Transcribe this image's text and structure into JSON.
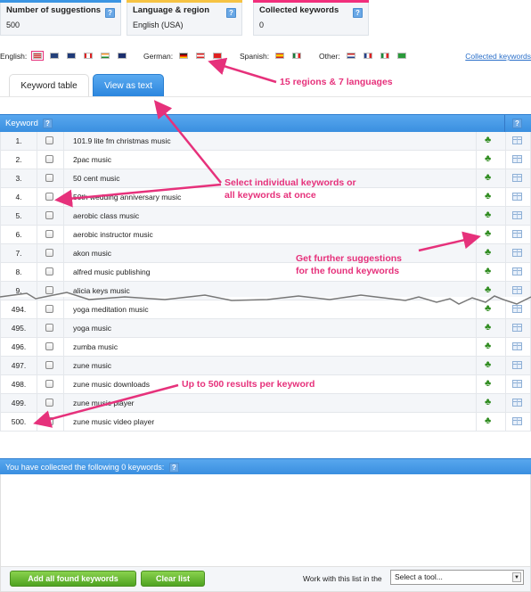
{
  "stats": [
    {
      "title": "Number of suggestions",
      "value": "500",
      "color": "#3b95e3"
    },
    {
      "title": "Language & region",
      "value": "English (USA)",
      "color": "#f6c343"
    },
    {
      "title": "Collected keywords",
      "value": "0",
      "color": "#f12f7c"
    }
  ],
  "help_label": "?",
  "languages": {
    "english_label": "English:",
    "english_flags": [
      "flag-usa",
      "flag-uk",
      "flag-australia",
      "flag-canada",
      "flag-india",
      "flag-new-zealand"
    ],
    "german_label": "German:",
    "german_flags": [
      "flag-germany",
      "flag-austria",
      "flag-switzerland"
    ],
    "spanish_label": "Spanish:",
    "spanish_flags": [
      "flag-spain",
      "flag-mexico"
    ],
    "other_label": "Other:",
    "other_flags": [
      "flag-netherlands",
      "flag-france",
      "flag-italy",
      "flag-brazil"
    ],
    "collected_link": "Collected keywords"
  },
  "tabs": [
    {
      "label": "Keyword table",
      "active": true
    },
    {
      "label": "View as text",
      "active": false
    }
  ],
  "table": {
    "header": "Keyword",
    "rows": [
      {
        "num": "1.",
        "keyword": "101.9 lite fm christmas music"
      },
      {
        "num": "2.",
        "keyword": "2pac music"
      },
      {
        "num": "3.",
        "keyword": "50 cent music"
      },
      {
        "num": "4.",
        "keyword": "50th wedding anniversary music"
      },
      {
        "num": "5.",
        "keyword": "aerobic class music"
      },
      {
        "num": "6.",
        "keyword": "aerobic instructor music"
      },
      {
        "num": "7.",
        "keyword": "akon music"
      },
      {
        "num": "8.",
        "keyword": "alfred music publishing"
      },
      {
        "num": "9.",
        "keyword": "alicia keys music"
      },
      {
        "num": "494.",
        "keyword": "yoga meditation music"
      },
      {
        "num": "495.",
        "keyword": "yoga music"
      },
      {
        "num": "496.",
        "keyword": "zumba music"
      },
      {
        "num": "497.",
        "keyword": "zune music"
      },
      {
        "num": "498.",
        "keyword": "zune music downloads"
      },
      {
        "num": "499.",
        "keyword": "zune music player"
      },
      {
        "num": "500.",
        "keyword": "zune music video player"
      }
    ]
  },
  "collected": {
    "header": "You have collected the following 0 keywords:",
    "add_all_label": "Add all found keywords",
    "clear_label": "Clear list",
    "tool_label": "Work with this list in the",
    "tool_select": "Select a tool..."
  },
  "annotations": {
    "regions": "15 regions & 7 languages",
    "select_line1": "Select individual keywords or",
    "select_line2": "all keywords at once",
    "further_line1": "Get further suggestions",
    "further_line2": "for the found keywords",
    "results": "Up to 500 results per keyword"
  },
  "colors": {
    "accent_blue": "#3a8fe0",
    "annotation_pink": "#e6317b",
    "button_green": "#5fb22e"
  }
}
